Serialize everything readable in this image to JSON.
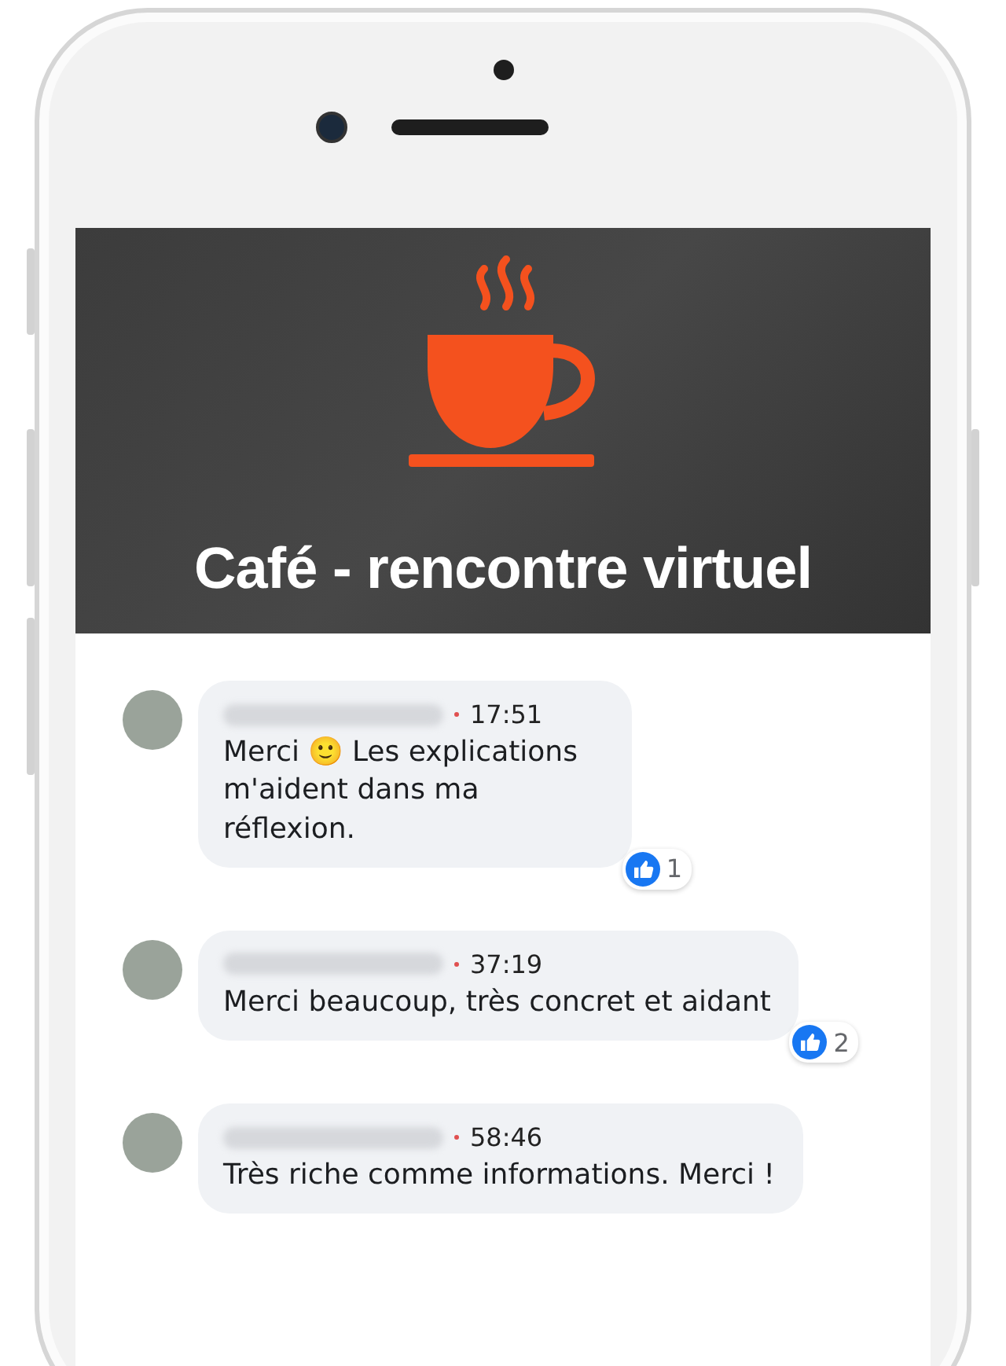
{
  "banner": {
    "title": "Café - rencontre virtuel"
  },
  "comments": [
    {
      "time": "17:51",
      "text": "Merci 🙂 Les explications m'aident dans ma réflexion.",
      "reactions": {
        "count": "1"
      }
    },
    {
      "time": "37:19",
      "text": "Merci beaucoup, très concret et aidant",
      "reactions": {
        "count": "2"
      }
    },
    {
      "time": "58:46",
      "text": "Très riche comme informations. Merci !"
    }
  ]
}
